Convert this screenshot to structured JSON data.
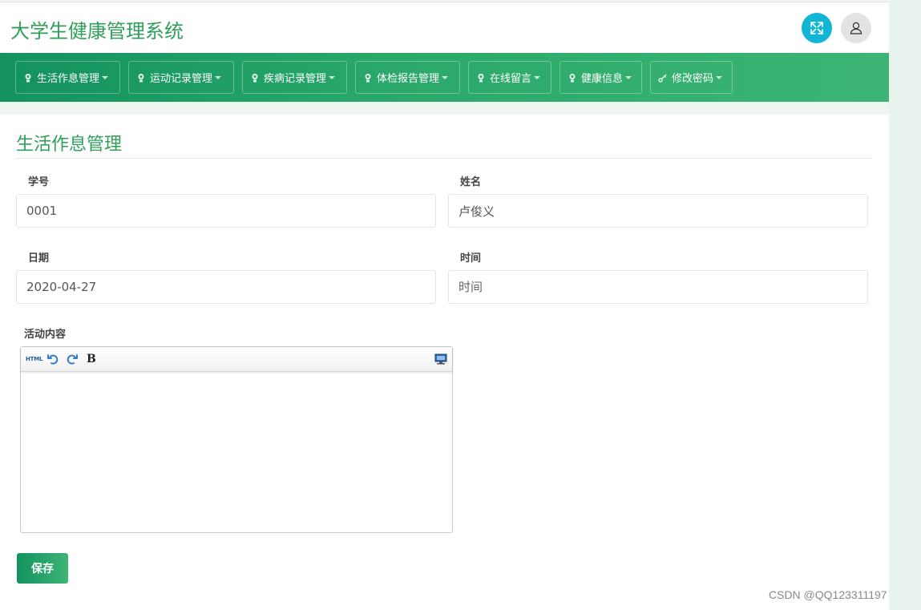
{
  "app": {
    "title": "大学生健康管理系统"
  },
  "nav": {
    "items": [
      {
        "label": "生活作息管理"
      },
      {
        "label": "运动记录管理"
      },
      {
        "label": "疾病记录管理"
      },
      {
        "label": "体检报告管理"
      },
      {
        "label": "在线留言"
      },
      {
        "label": "健康信息"
      },
      {
        "label": "修改密码"
      }
    ]
  },
  "form": {
    "title": "生活作息管理",
    "student_id": {
      "label": "学号",
      "value": "0001"
    },
    "name": {
      "label": "姓名",
      "value": "卢俊义"
    },
    "date": {
      "label": "日期",
      "value": "2020-04-27"
    },
    "time": {
      "label": "时间",
      "value": "",
      "placeholder": "时间"
    },
    "content": {
      "label": "活动内容"
    },
    "editor_toolbar": {
      "html_label": "HTML",
      "bold_label": "B"
    },
    "save_label": "保存"
  },
  "watermark": "CSDN @QQ123311197",
  "colors": {
    "brand": "#2f9e58",
    "nav_start": "#13915f",
    "nav_end": "#3cb574",
    "expand_btn": "#12b5d4"
  }
}
